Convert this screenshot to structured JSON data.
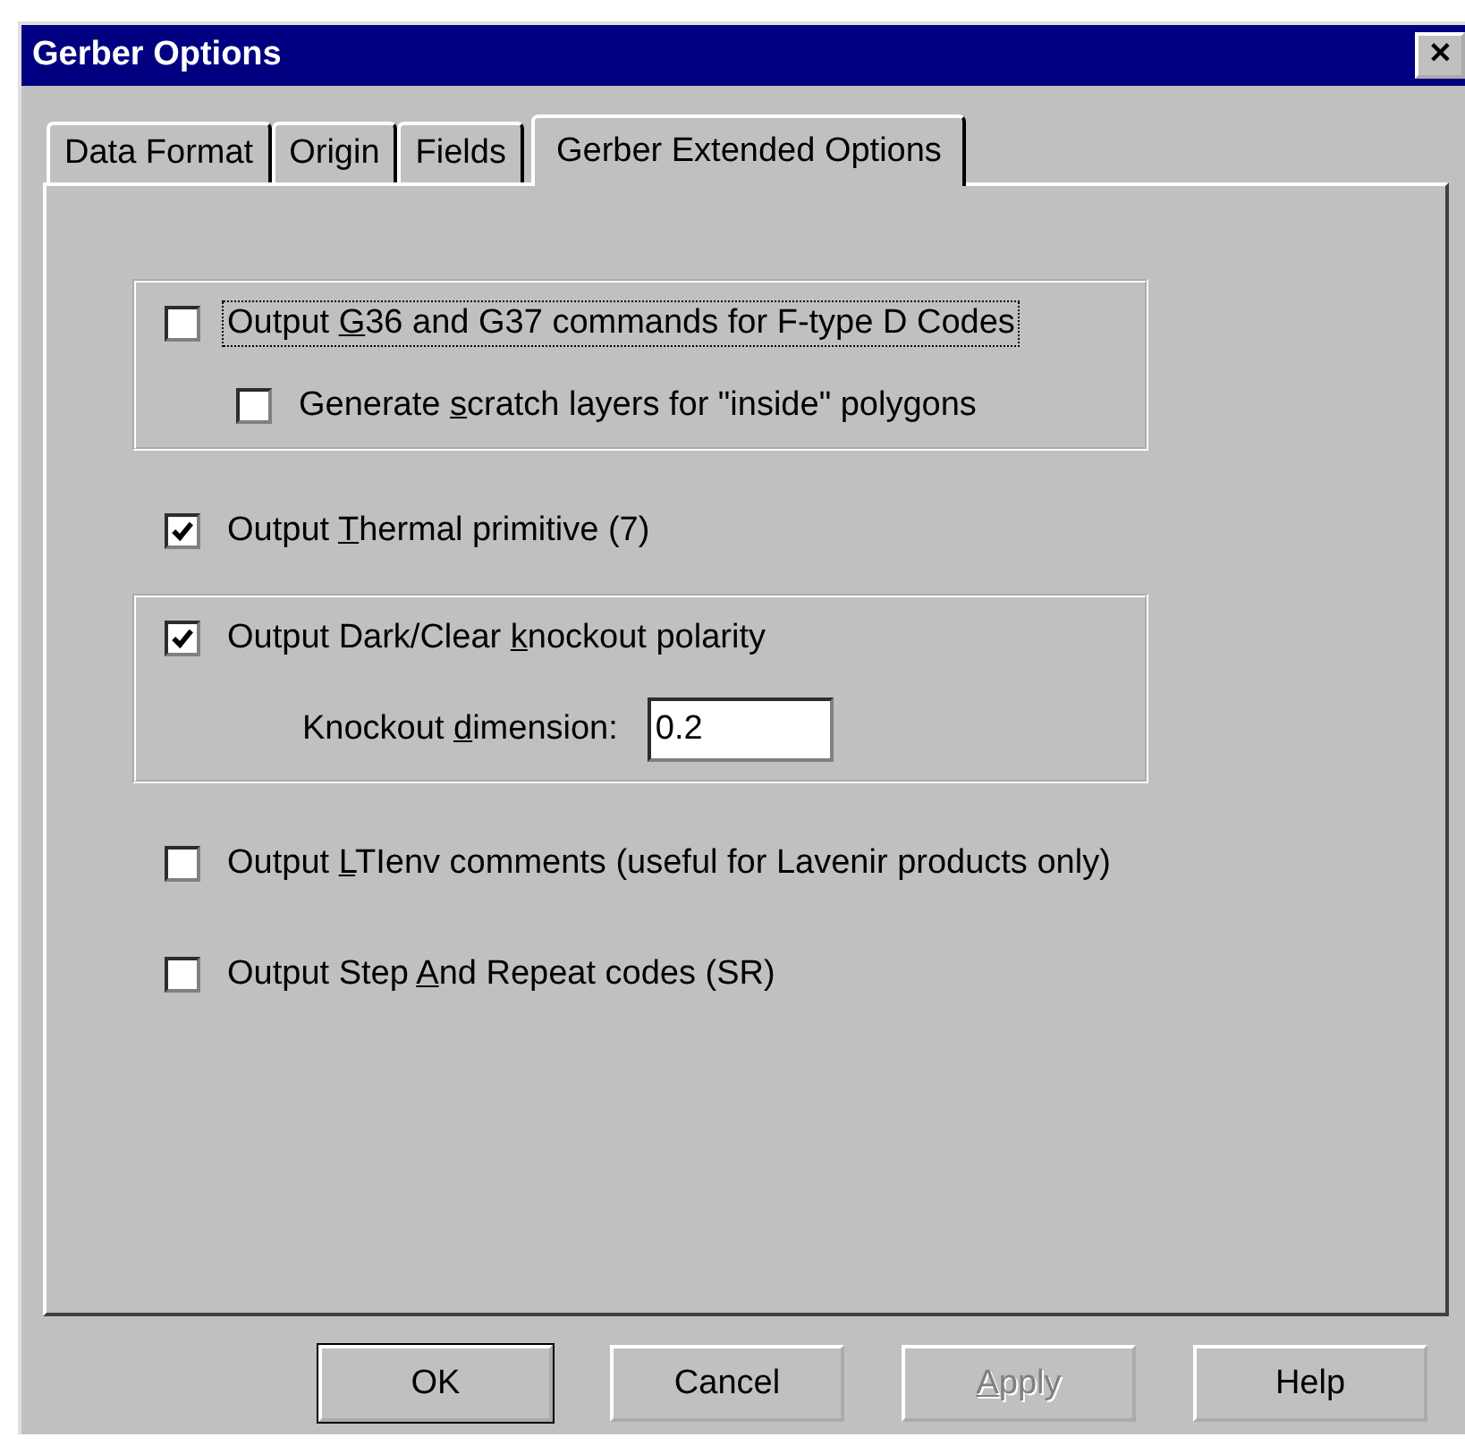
{
  "window": {
    "title": "Gerber Options",
    "close_symbol": "✕"
  },
  "tabs": [
    {
      "label": "Data Format",
      "selected": false
    },
    {
      "label": "Origin",
      "selected": false
    },
    {
      "label": "Fields",
      "selected": false
    },
    {
      "label": "Gerber Extended Options",
      "selected": true
    }
  ],
  "options": [
    {
      "kind": "group",
      "items": [
        {
          "kind": "checkbox",
          "before": "Output ",
          "key": "G",
          "after": "36 and G37 commands for F-type D Codes",
          "checked": false,
          "focused": true
        },
        {
          "kind": "subcheckbox",
          "before": "Generate ",
          "key": "s",
          "after": "cratch layers for \"inside\" polygons",
          "checked": false,
          "focused": false
        }
      ]
    },
    {
      "kind": "checkbox",
      "before": "Output ",
      "key": "T",
      "after": "hermal primitive (7)",
      "checked": true,
      "focused": false
    },
    {
      "kind": "group",
      "items": [
        {
          "kind": "checkbox",
          "before": "Output Dark/Clear ",
          "key": "k",
          "after": "nockout polarity",
          "checked": true,
          "focused": false
        },
        {
          "kind": "field",
          "before": "Knockout ",
          "key": "d",
          "after": "imension:",
          "value": "0.2"
        }
      ]
    },
    {
      "kind": "checkbox",
      "before": "Output ",
      "key": "L",
      "after": "TIenv comments (useful for Lavenir products only)",
      "checked": false,
      "focused": false
    },
    {
      "kind": "checkbox",
      "before": "Output Step ",
      "key": "A",
      "after": "nd Repeat codes (SR)",
      "checked": false,
      "focused": false
    }
  ],
  "buttons": [
    {
      "label": "OK",
      "default": true,
      "disabled": false
    },
    {
      "label": "Cancel",
      "default": false,
      "disabled": false
    },
    {
      "key": "A",
      "label": "pply",
      "default": false,
      "disabled": true
    },
    {
      "label": "Help",
      "default": false,
      "disabled": false
    }
  ]
}
